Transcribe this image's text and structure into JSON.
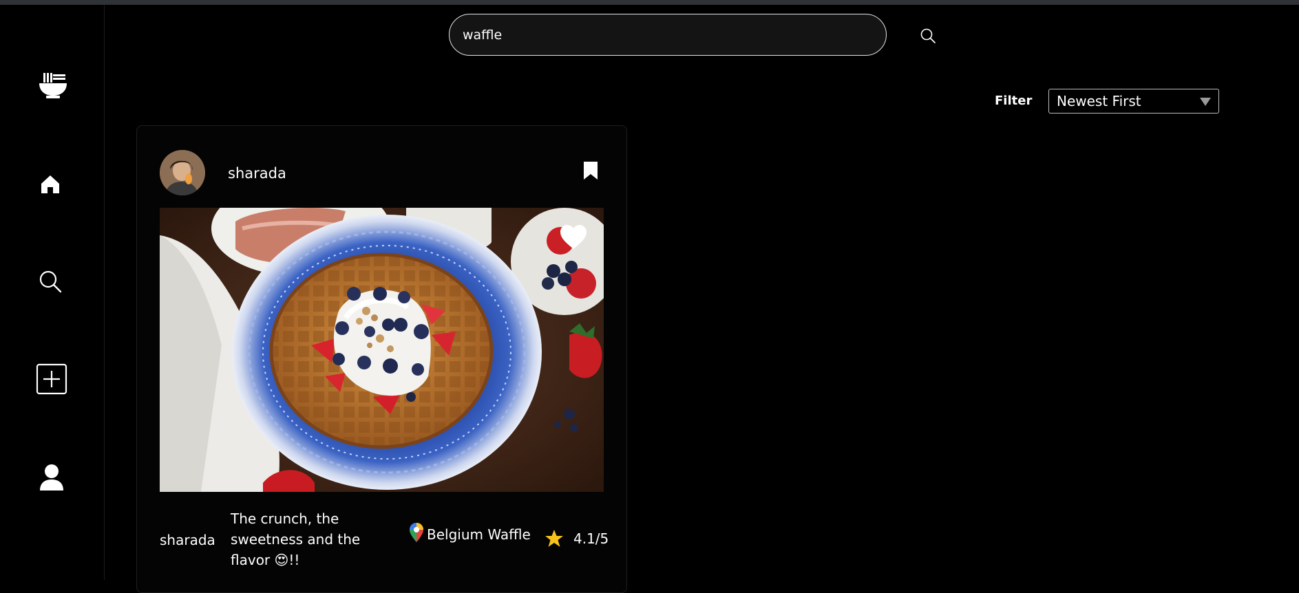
{
  "search": {
    "value": "waffle",
    "icon": "search-icon"
  },
  "sidebar": {
    "items": [
      {
        "name": "logo",
        "icon": "bowl-icon"
      },
      {
        "name": "home",
        "icon": "home-icon"
      },
      {
        "name": "search",
        "icon": "search-icon"
      },
      {
        "name": "create",
        "icon": "plus-square-icon"
      },
      {
        "name": "profile",
        "icon": "user-icon"
      }
    ]
  },
  "filter": {
    "label": "Filter",
    "selected": "Newest First"
  },
  "post": {
    "author": "sharada",
    "caption_user": "sharada",
    "caption_lines": [
      "The crunch, the",
      "sweetness and the",
      "flavor 😍!!"
    ],
    "location": "Belgium Waffle",
    "rating": "4.1/5",
    "liked": true,
    "bookmarked": true,
    "image_subject": "waffle with cream, blueberries and strawberries on a blue plate"
  },
  "colors": {
    "background": "#000000",
    "topbar": "#2f3237",
    "star": "#f7c21b",
    "text": "#ffffff"
  }
}
